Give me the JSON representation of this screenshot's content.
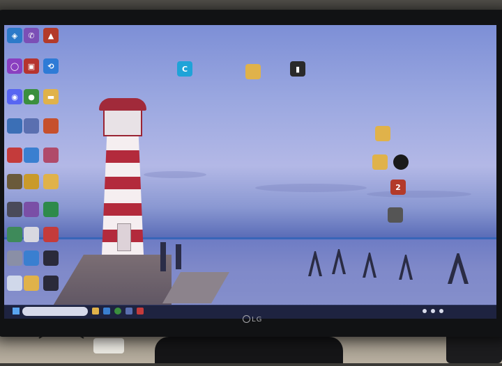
{
  "monitor": {
    "brand": "LG"
  },
  "colors": {
    "sky_top": "#7d8fd6",
    "water": "#7f89c9",
    "lighthouse_red": "#b32a3c",
    "taskbar": "#1e2340"
  },
  "desktop_icons": [
    {
      "name": "app-icon-1",
      "glyph": "◈",
      "color": "#2c7ac9"
    },
    {
      "name": "viber-icon",
      "glyph": "✆",
      "color": "#7b4fb6"
    },
    {
      "name": "app-icon-3",
      "glyph": "▲",
      "color": "#b33a2a"
    },
    {
      "name": "app-icon-4",
      "glyph": "◯",
      "color": "#8a3fc0"
    },
    {
      "name": "app-icon-5",
      "glyph": "▣",
      "color": "#b6342f"
    },
    {
      "name": "app-icon-6",
      "glyph": "⟲",
      "color": "#2e7bd6"
    },
    {
      "name": "discord-icon",
      "glyph": "◉",
      "color": "#5865f2"
    },
    {
      "name": "chrome-icon",
      "glyph": "●",
      "color": "#3b8f3e"
    },
    {
      "name": "folder-icon",
      "glyph": "▬",
      "color": "#e0b24a"
    },
    {
      "name": "folder-icon-2",
      "glyph": "▬",
      "color": "#e0b24a"
    },
    {
      "name": "app-icon-ccleaner",
      "glyph": "C",
      "color": "#1fa3d8"
    },
    {
      "name": "app-icon-dark",
      "glyph": "▮",
      "color": "#2a2a2a"
    },
    {
      "name": "app-icon-red-2",
      "glyph": "2",
      "color": "#b33a2a"
    }
  ]
}
